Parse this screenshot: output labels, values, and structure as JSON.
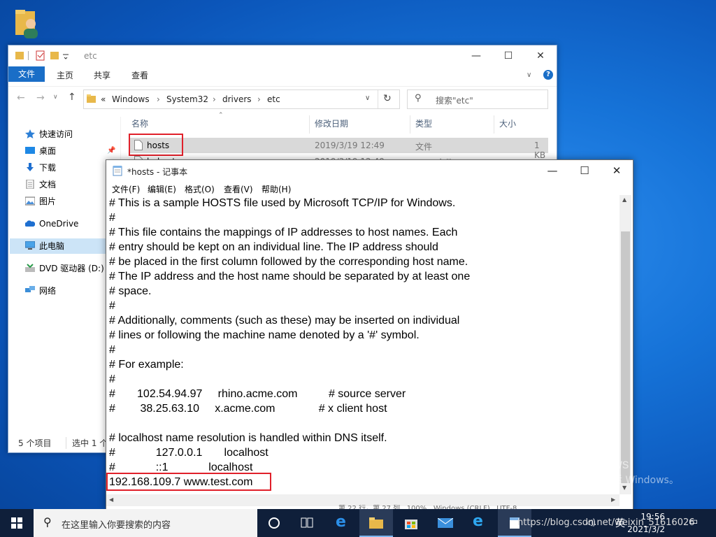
{
  "explorer": {
    "title": "etc",
    "ribbon_tabs": [
      "文件",
      "主页",
      "共享",
      "查看"
    ],
    "breadcrumb_prefix": "«",
    "breadcrumb": [
      "Windows",
      "System32",
      "drivers",
      "etc"
    ],
    "search_placeholder": "搜索\"etc\"",
    "sidebar": [
      "快速访问",
      "桌面",
      "下载",
      "文档",
      "图片",
      "OneDrive",
      "此电脑",
      "DVD 驱动器 (D:)",
      "网络"
    ],
    "columns": [
      "名称",
      "修改日期",
      "类型",
      "大小"
    ],
    "files": [
      {
        "name": "hosts",
        "date": "2019/3/19 12:49",
        "type": "文件",
        "size": "1 KB"
      },
      {
        "name": "lmhosts.sam",
        "date": "2019/3/19 12:49",
        "type": "SAM 文件",
        "size": ""
      }
    ],
    "status_count": "5 个项目",
    "status_selected": "选中 1 个项"
  },
  "notepad": {
    "title": "*hosts - 记事本",
    "menu": [
      "文件(F)",
      "编辑(E)",
      "格式(O)",
      "查看(V)",
      "帮助(H)"
    ],
    "lines": [
      "# This is a sample HOSTS file used by Microsoft TCP/IP for Windows.",
      "#",
      "# This file contains the mappings of IP addresses to host names. Each",
      "# entry should be kept on an individual line. The IP address should",
      "# be placed in the first column followed by the corresponding host name.",
      "# The IP address and the host name should be separated by at least one",
      "# space.",
      "#",
      "# Additionally, comments (such as these) may be inserted on individual",
      "# lines or following the machine name denoted by a '#' symbol.",
      "#",
      "# For example:",
      "#",
      "#       102.54.94.97     rhino.acme.com          # source server",
      "#        38.25.63.10     x.acme.com              # x client host",
      "",
      "# localhost name resolution is handled within DNS itself.",
      "#             127.0.0.1       localhost",
      "#             ::1             localhost",
      "192.168.109.7 www.test.com"
    ],
    "status_text": "第 22 行，第 27 列   100%   Windows (CRLF)   UTF-8"
  },
  "watermark": {
    "line1": "激活 Windows",
    "line2": "转到\"设置\"以激活 Windows。"
  },
  "taskbar": {
    "search_placeholder": "在这里输入你要搜索的内容",
    "ime": "英",
    "time": "19:56",
    "date": "2021/3/2",
    "url_overlay": "https://blog.csdn.net/weixin_51616026"
  }
}
